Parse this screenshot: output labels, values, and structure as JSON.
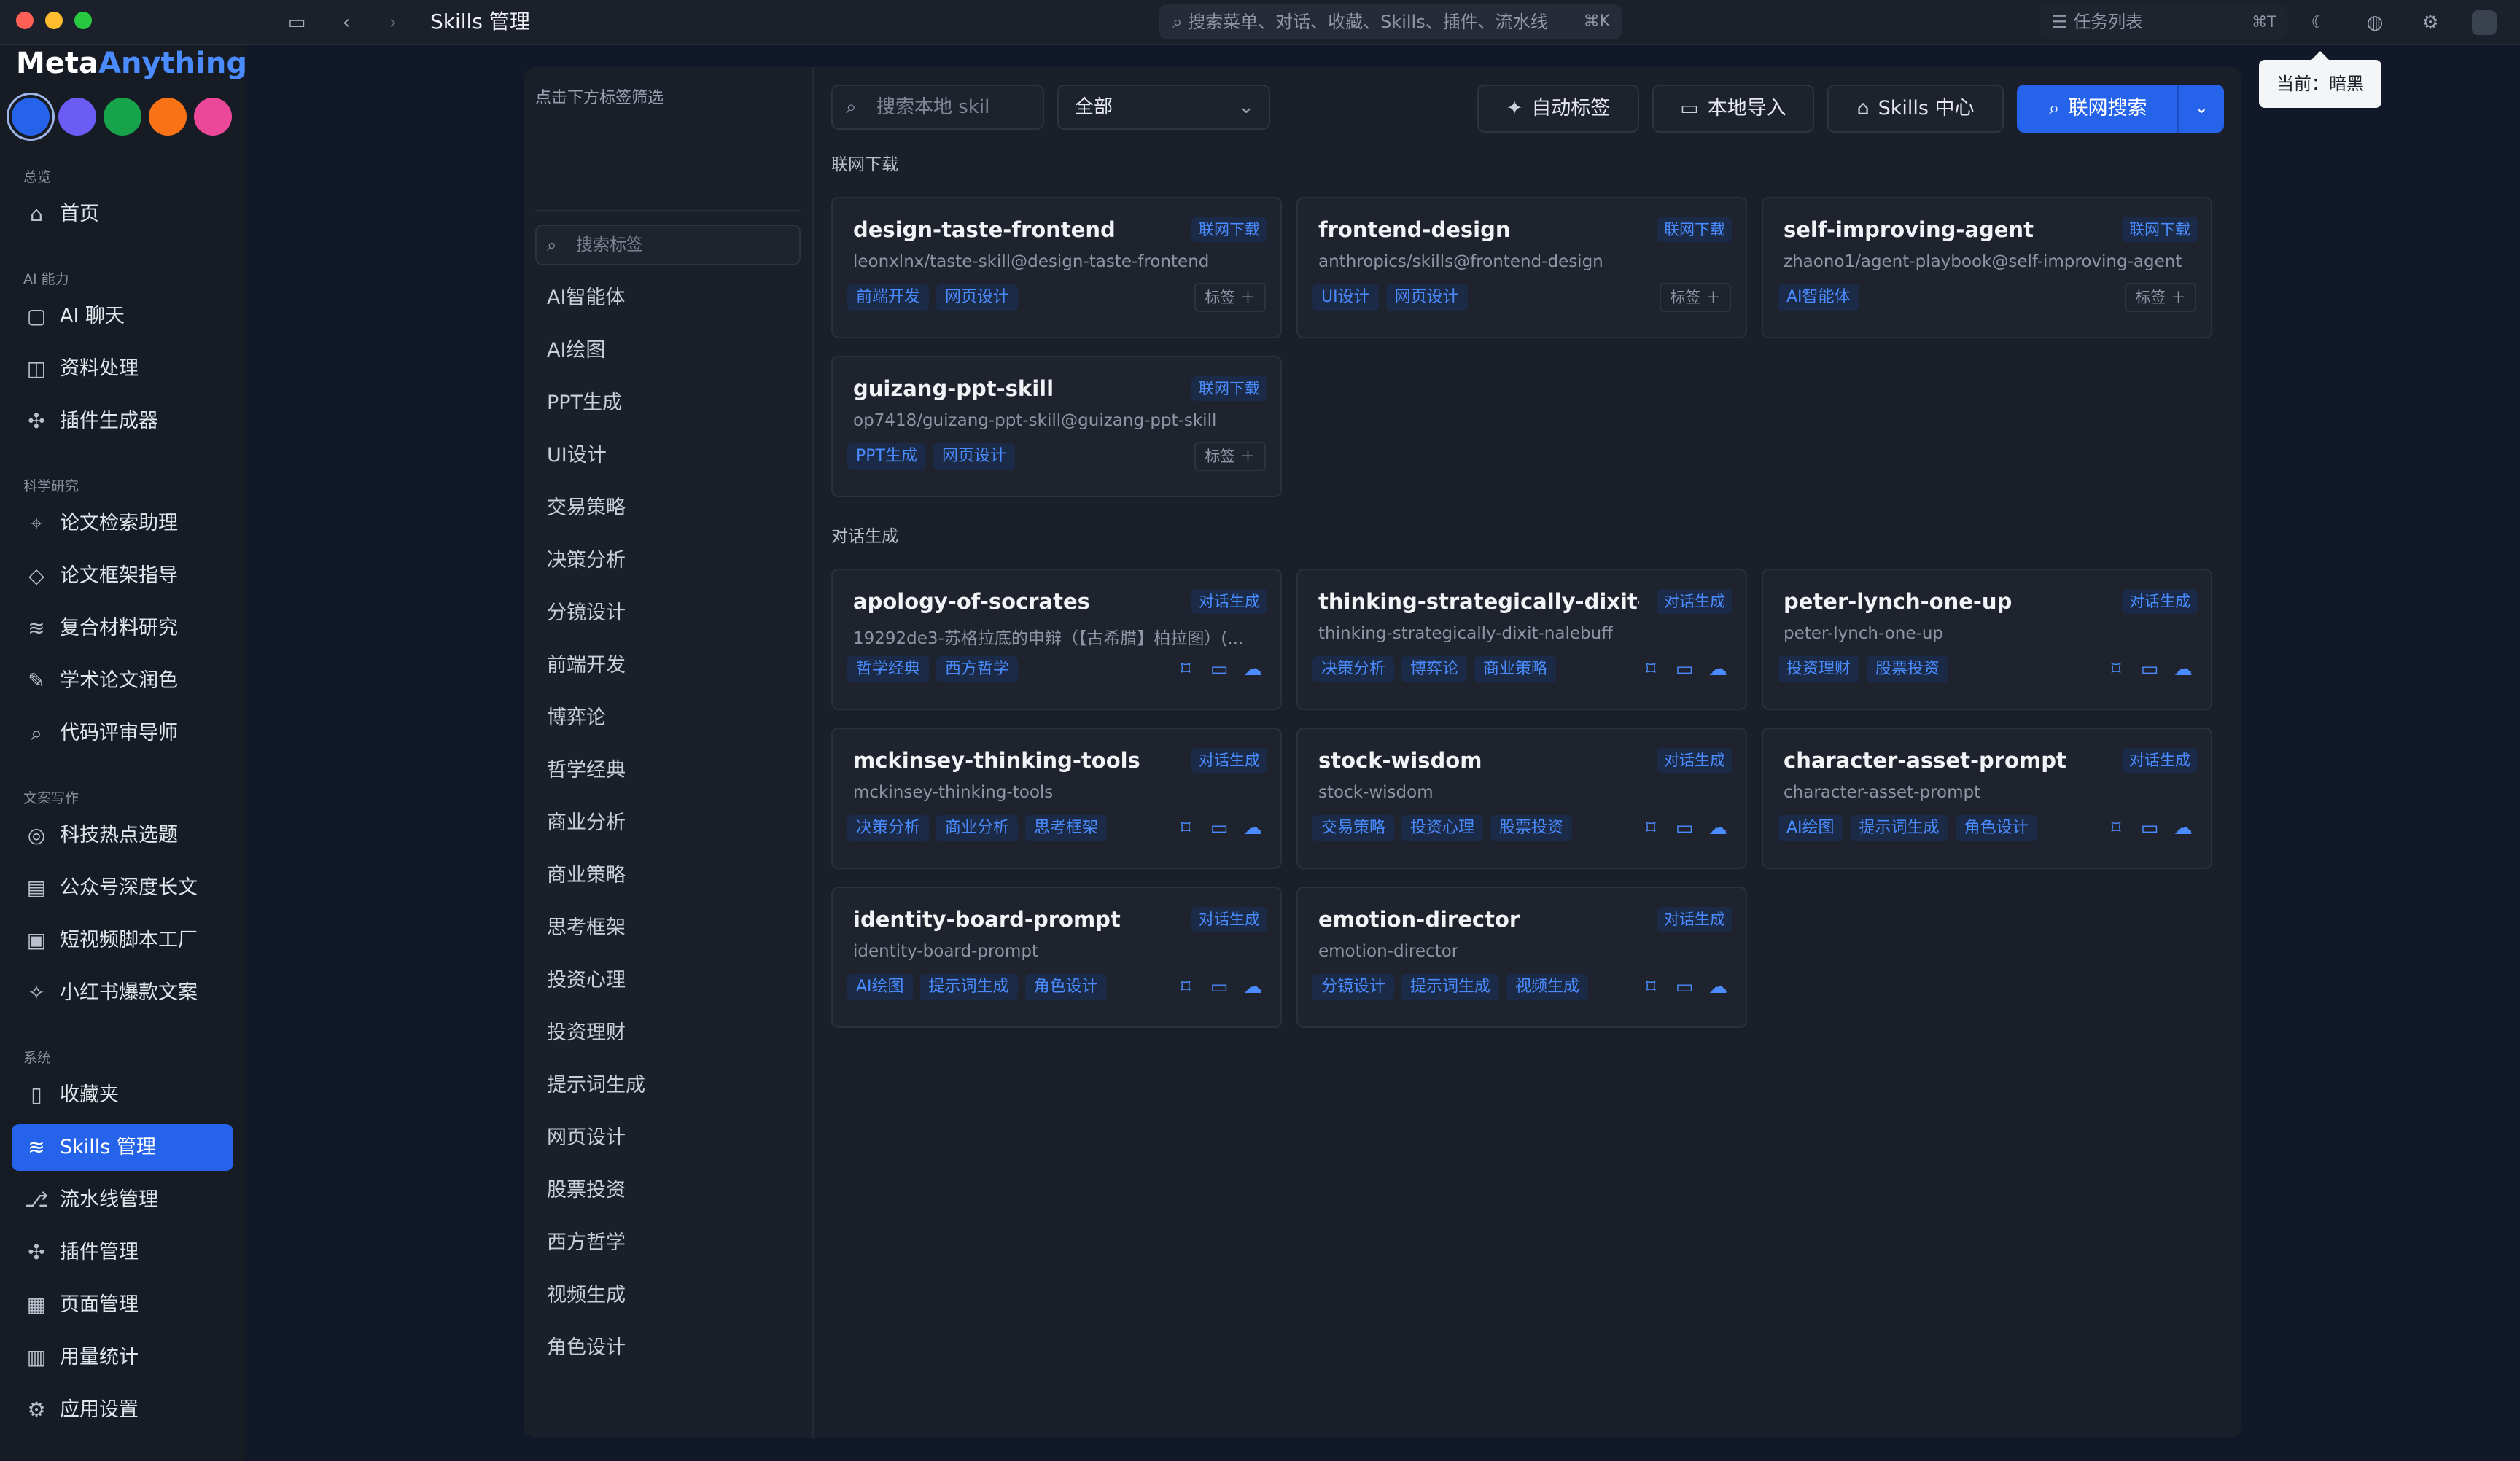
{
  "titlebar": {
    "title": "Skills 管理",
    "search_placeholder": "搜索菜单、对话、收藏、Skills、插件、流水线",
    "search_kbd": "⌘K",
    "tasklist_label": "任务列表",
    "tasklist_kbd": "⌘T",
    "tooltip": "当前：暗黑"
  },
  "brand": {
    "part1": "Meta",
    "part2": "Anything"
  },
  "theme_colors": [
    "#2563eb",
    "#6b5cf6",
    "#16a34a",
    "#f97316",
    "#ec4899"
  ],
  "sidebar": {
    "sections": {
      "overview": "总览",
      "ai": "AI 能力",
      "research": "科学研究",
      "writing": "文案写作",
      "system": "系统"
    },
    "items": [
      {
        "label": "首页",
        "icon": "home-icon"
      },
      {
        "label": "AI 聊天",
        "icon": "chat-icon"
      },
      {
        "label": "资料处理",
        "icon": "book-icon"
      },
      {
        "label": "插件生成器",
        "icon": "puzzle-icon"
      },
      {
        "label": "论文检索助理",
        "icon": "telescope-icon"
      },
      {
        "label": "论文框架指导",
        "icon": "graduation-icon"
      },
      {
        "label": "复合材料研究",
        "icon": "layers-icon"
      },
      {
        "label": "学术论文润色",
        "icon": "pen-icon"
      },
      {
        "label": "代码评审导师",
        "icon": "search-code-icon"
      },
      {
        "label": "科技热点选题",
        "icon": "target-icon"
      },
      {
        "label": "公众号深度长文",
        "icon": "document-icon"
      },
      {
        "label": "短视频脚本工厂",
        "icon": "clapper-icon"
      },
      {
        "label": "小红书爆款文案",
        "icon": "sparkle-icon"
      },
      {
        "label": "收藏夹",
        "icon": "bookmark-icon"
      },
      {
        "label": "Skills 管理",
        "icon": "layers-icon"
      },
      {
        "label": "流水线管理",
        "icon": "workflow-icon"
      },
      {
        "label": "插件管理",
        "icon": "puzzle-icon"
      },
      {
        "label": "页面管理",
        "icon": "grid-icon"
      },
      {
        "label": "用量统计",
        "icon": "chart-icon"
      },
      {
        "label": "应用设置",
        "icon": "gear-icon"
      }
    ]
  },
  "tags": {
    "hint": "点击下方标签筛选",
    "search_placeholder": "搜索标签",
    "list": [
      "AI智能体",
      "AI绘图",
      "PPT生成",
      "UI设计",
      "交易策略",
      "决策分析",
      "分镜设计",
      "前端开发",
      "博弈论",
      "哲学经典",
      "商业分析",
      "商业策略",
      "思考框架",
      "投资心理",
      "投资理财",
      "提示词生成",
      "网页设计",
      "股票投资",
      "西方哲学",
      "视频生成",
      "角色设计"
    ]
  },
  "toolbar": {
    "search_placeholder": "搜索本地 skil",
    "filter_value": "全部",
    "auto_tag": "自动标签",
    "local_import": "本地导入",
    "skills_center": "Skills 中心",
    "web_search": "联网搜索"
  },
  "sections": {
    "downloaded": "联网下载",
    "generated": "对话生成"
  },
  "tag_add_label": "标签",
  "downloaded_cards": [
    {
      "name": "design-taste-frontend",
      "badge": "联网下载",
      "sub": "leonxlnx/taste-skill@design-taste-frontend",
      "chips": [
        "前端开发",
        "网页设计"
      ]
    },
    {
      "name": "frontend-design",
      "badge": "联网下载",
      "sub": "anthropics/skills@frontend-design",
      "chips": [
        "UI设计",
        "网页设计"
      ]
    },
    {
      "name": "self-improving-agent",
      "badge": "联网下载",
      "sub": "zhaono1/agent-playbook@self-improving-agent",
      "chips": [
        "AI智能体"
      ]
    },
    {
      "name": "guizang-ppt-skill",
      "badge": "联网下载",
      "sub": "op7418/guizang-ppt-skill@guizang-ppt-skill",
      "chips": [
        "PPT生成",
        "网页设计"
      ]
    }
  ],
  "generated_cards": [
    {
      "name": "apology-of-socrates",
      "badge": "对话生成",
      "sub": "19292de3-苏格拉底的申辩（【古希腊】柏拉图）(...",
      "chips": [
        "哲学经典",
        "西方哲学"
      ]
    },
    {
      "name": "thinking-strategically-dixit-...",
      "badge": "对话生成",
      "sub": "thinking-strategically-dixit-nalebuff",
      "chips": [
        "决策分析",
        "博弈论",
        "商业策略"
      ]
    },
    {
      "name": "peter-lynch-one-up",
      "badge": "对话生成",
      "sub": "peter-lynch-one-up",
      "chips": [
        "投资理财",
        "股票投资"
      ]
    },
    {
      "name": "mckinsey-thinking-tools",
      "badge": "对话生成",
      "sub": "mckinsey-thinking-tools",
      "chips": [
        "决策分析",
        "商业分析",
        "思考框架"
      ]
    },
    {
      "name": "stock-wisdom",
      "badge": "对话生成",
      "sub": "stock-wisdom",
      "chips": [
        "交易策略",
        "投资心理",
        "股票投资"
      ]
    },
    {
      "name": "character-asset-prompt",
      "badge": "对话生成",
      "sub": "character-asset-prompt",
      "chips": [
        "AI绘图",
        "提示词生成",
        "角色设计"
      ]
    },
    {
      "name": "identity-board-prompt",
      "badge": "对话生成",
      "sub": "identity-board-prompt",
      "chips": [
        "AI绘图",
        "提示词生成",
        "角色设计"
      ]
    },
    {
      "name": "emotion-director",
      "badge": "对话生成",
      "sub": "emotion-director",
      "chips": [
        "分镜设计",
        "提示词生成",
        "视频生成"
      ]
    }
  ]
}
